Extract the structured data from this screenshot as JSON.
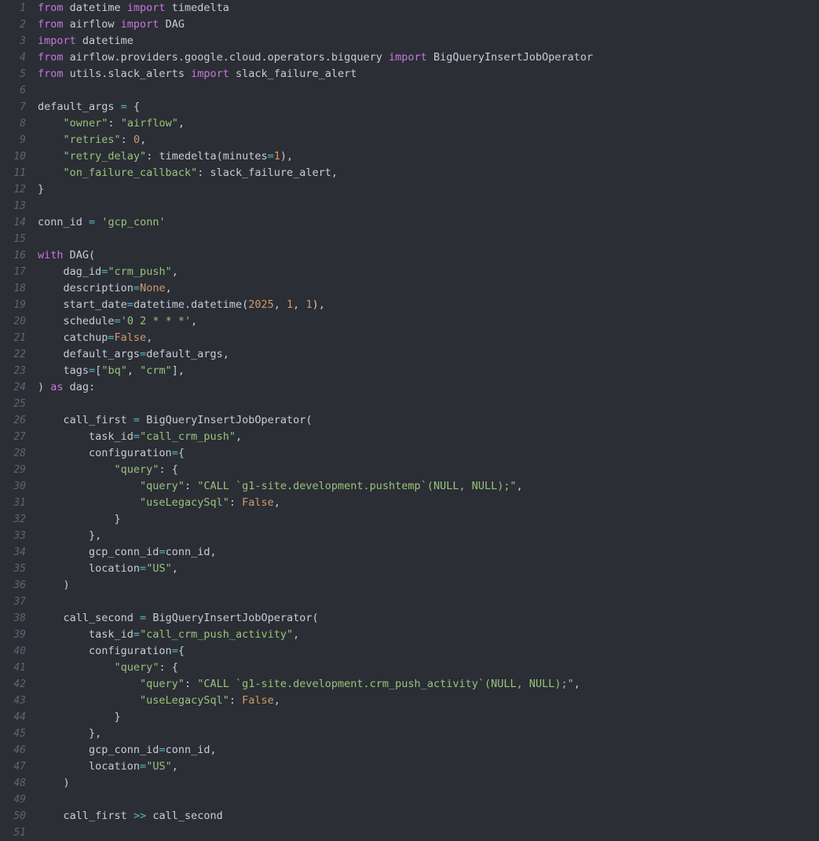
{
  "editor": {
    "language": "python",
    "colors": {
      "background": "#2b2e35",
      "keyword": "#c678dd",
      "string": "#98c379",
      "number": "#d19a66",
      "operator": "#56b6c2",
      "text": "#c7ccd6",
      "line_number": "#5f6470"
    },
    "lines": [
      {
        "n": "1",
        "tokens": [
          [
            "kw",
            "from"
          ],
          [
            "id",
            " datetime "
          ],
          [
            "kw",
            "import"
          ],
          [
            "id",
            " timedelta"
          ]
        ]
      },
      {
        "n": "2",
        "tokens": [
          [
            "kw",
            "from"
          ],
          [
            "id",
            " airflow "
          ],
          [
            "kw",
            "import"
          ],
          [
            "id",
            " DAG"
          ]
        ]
      },
      {
        "n": "3",
        "tokens": [
          [
            "kw",
            "import"
          ],
          [
            "id",
            " datetime"
          ]
        ]
      },
      {
        "n": "4",
        "tokens": [
          [
            "kw",
            "from"
          ],
          [
            "id",
            " airflow.providers.google.cloud.operators.bigquery "
          ],
          [
            "kw",
            "import"
          ],
          [
            "id",
            " BigQueryInsertJobOperator"
          ]
        ]
      },
      {
        "n": "5",
        "tokens": [
          [
            "kw",
            "from"
          ],
          [
            "id",
            " utils.slack_alerts "
          ],
          [
            "kw",
            "import"
          ],
          [
            "id",
            " slack_failure_alert"
          ]
        ]
      },
      {
        "n": "6",
        "tokens": []
      },
      {
        "n": "7",
        "tokens": [
          [
            "id",
            "default_args "
          ],
          [
            "op",
            "="
          ],
          [
            "id",
            " {"
          ]
        ]
      },
      {
        "n": "8",
        "tokens": [
          [
            "id",
            "    "
          ],
          [
            "str",
            "\"owner\""
          ],
          [
            "id",
            ": "
          ],
          [
            "str",
            "\"airflow\""
          ],
          [
            "id",
            ","
          ]
        ]
      },
      {
        "n": "9",
        "tokens": [
          [
            "id",
            "    "
          ],
          [
            "str",
            "\"retries\""
          ],
          [
            "id",
            ": "
          ],
          [
            "num",
            "0"
          ],
          [
            "id",
            ","
          ]
        ]
      },
      {
        "n": "10",
        "tokens": [
          [
            "id",
            "    "
          ],
          [
            "str",
            "\"retry_delay\""
          ],
          [
            "id",
            ": timedelta(minutes"
          ],
          [
            "op",
            "="
          ],
          [
            "num",
            "1"
          ],
          [
            "id",
            "),"
          ]
        ]
      },
      {
        "n": "11",
        "tokens": [
          [
            "id",
            "    "
          ],
          [
            "str",
            "\"on_failure_callback\""
          ],
          [
            "id",
            ": slack_failure_alert,"
          ]
        ]
      },
      {
        "n": "12",
        "tokens": [
          [
            "id",
            "}"
          ]
        ]
      },
      {
        "n": "13",
        "tokens": []
      },
      {
        "n": "14",
        "tokens": [
          [
            "id",
            "conn_id "
          ],
          [
            "op",
            "="
          ],
          [
            "id",
            " "
          ],
          [
            "str",
            "'gcp_conn'"
          ]
        ]
      },
      {
        "n": "15",
        "tokens": []
      },
      {
        "n": "16",
        "tokens": [
          [
            "kw",
            "with"
          ],
          [
            "id",
            " DAG("
          ]
        ]
      },
      {
        "n": "17",
        "tokens": [
          [
            "id",
            "    dag_id"
          ],
          [
            "op",
            "="
          ],
          [
            "str",
            "\"crm_push\""
          ],
          [
            "id",
            ","
          ]
        ]
      },
      {
        "n": "18",
        "tokens": [
          [
            "id",
            "    description"
          ],
          [
            "op",
            "="
          ],
          [
            "num",
            "None"
          ],
          [
            "id",
            ","
          ]
        ]
      },
      {
        "n": "19",
        "tokens": [
          [
            "id",
            "    start_date"
          ],
          [
            "op",
            "="
          ],
          [
            "id",
            "datetime.datetime("
          ],
          [
            "num",
            "2025"
          ],
          [
            "id",
            ", "
          ],
          [
            "num",
            "1"
          ],
          [
            "id",
            ", "
          ],
          [
            "num",
            "1"
          ],
          [
            "id",
            "),"
          ]
        ]
      },
      {
        "n": "20",
        "tokens": [
          [
            "id",
            "    schedule"
          ],
          [
            "op",
            "="
          ],
          [
            "str",
            "'0 2 * * *'"
          ],
          [
            "id",
            ","
          ]
        ]
      },
      {
        "n": "21",
        "tokens": [
          [
            "id",
            "    catchup"
          ],
          [
            "op",
            "="
          ],
          [
            "num",
            "False"
          ],
          [
            "id",
            ","
          ]
        ]
      },
      {
        "n": "22",
        "tokens": [
          [
            "id",
            "    default_args"
          ],
          [
            "op",
            "="
          ],
          [
            "id",
            "default_args,"
          ]
        ]
      },
      {
        "n": "23",
        "tokens": [
          [
            "id",
            "    tags"
          ],
          [
            "op",
            "="
          ],
          [
            "id",
            "["
          ],
          [
            "str",
            "\"bq\""
          ],
          [
            "id",
            ", "
          ],
          [
            "str",
            "\"crm\""
          ],
          [
            "id",
            "],"
          ]
        ]
      },
      {
        "n": "24",
        "tokens": [
          [
            "id",
            ") "
          ],
          [
            "kw",
            "as"
          ],
          [
            "id",
            " dag:"
          ]
        ]
      },
      {
        "n": "25",
        "tokens": []
      },
      {
        "n": "26",
        "tokens": [
          [
            "id",
            "    call_first "
          ],
          [
            "op",
            "="
          ],
          [
            "id",
            " BigQueryInsertJobOperator("
          ]
        ]
      },
      {
        "n": "27",
        "tokens": [
          [
            "id",
            "        task_id"
          ],
          [
            "op",
            "="
          ],
          [
            "str",
            "\"call_crm_push\""
          ],
          [
            "id",
            ","
          ]
        ]
      },
      {
        "n": "28",
        "tokens": [
          [
            "id",
            "        configuration"
          ],
          [
            "op",
            "="
          ],
          [
            "id",
            "{"
          ]
        ]
      },
      {
        "n": "29",
        "tokens": [
          [
            "id",
            "            "
          ],
          [
            "str",
            "\"query\""
          ],
          [
            "id",
            ": {"
          ]
        ]
      },
      {
        "n": "30",
        "tokens": [
          [
            "id",
            "                "
          ],
          [
            "str",
            "\"query\""
          ],
          [
            "id",
            ": "
          ],
          [
            "str",
            "\"CALL `g1-site.development.pushtemp`(NULL, NULL);\""
          ],
          [
            "id",
            ","
          ]
        ]
      },
      {
        "n": "31",
        "tokens": [
          [
            "id",
            "                "
          ],
          [
            "str",
            "\"useLegacySql\""
          ],
          [
            "id",
            ": "
          ],
          [
            "num",
            "False"
          ],
          [
            "id",
            ","
          ]
        ]
      },
      {
        "n": "32",
        "tokens": [
          [
            "id",
            "            }"
          ]
        ]
      },
      {
        "n": "33",
        "tokens": [
          [
            "id",
            "        },"
          ]
        ]
      },
      {
        "n": "34",
        "tokens": [
          [
            "id",
            "        gcp_conn_id"
          ],
          [
            "op",
            "="
          ],
          [
            "id",
            "conn_id,"
          ]
        ]
      },
      {
        "n": "35",
        "tokens": [
          [
            "id",
            "        location"
          ],
          [
            "op",
            "="
          ],
          [
            "str",
            "\"US\""
          ],
          [
            "id",
            ","
          ]
        ]
      },
      {
        "n": "36",
        "tokens": [
          [
            "id",
            "    )"
          ]
        ]
      },
      {
        "n": "37",
        "tokens": []
      },
      {
        "n": "38",
        "tokens": [
          [
            "id",
            "    call_second "
          ],
          [
            "op",
            "="
          ],
          [
            "id",
            " BigQueryInsertJobOperator("
          ]
        ]
      },
      {
        "n": "39",
        "tokens": [
          [
            "id",
            "        task_id"
          ],
          [
            "op",
            "="
          ],
          [
            "str",
            "\"call_crm_push_activity\""
          ],
          [
            "id",
            ","
          ]
        ]
      },
      {
        "n": "40",
        "tokens": [
          [
            "id",
            "        configuration"
          ],
          [
            "op",
            "="
          ],
          [
            "id",
            "{"
          ]
        ]
      },
      {
        "n": "41",
        "tokens": [
          [
            "id",
            "            "
          ],
          [
            "str",
            "\"query\""
          ],
          [
            "id",
            ": {"
          ]
        ]
      },
      {
        "n": "42",
        "tokens": [
          [
            "id",
            "                "
          ],
          [
            "str",
            "\"query\""
          ],
          [
            "id",
            ": "
          ],
          [
            "str",
            "\"CALL `g1-site.development.crm_push_activity`(NULL, NULL);\""
          ],
          [
            "id",
            ","
          ]
        ]
      },
      {
        "n": "43",
        "tokens": [
          [
            "id",
            "                "
          ],
          [
            "str",
            "\"useLegacySql\""
          ],
          [
            "id",
            ": "
          ],
          [
            "num",
            "False"
          ],
          [
            "id",
            ","
          ]
        ]
      },
      {
        "n": "44",
        "tokens": [
          [
            "id",
            "            }"
          ]
        ]
      },
      {
        "n": "45",
        "tokens": [
          [
            "id",
            "        },"
          ]
        ]
      },
      {
        "n": "46",
        "tokens": [
          [
            "id",
            "        gcp_conn_id"
          ],
          [
            "op",
            "="
          ],
          [
            "id",
            "conn_id,"
          ]
        ]
      },
      {
        "n": "47",
        "tokens": [
          [
            "id",
            "        location"
          ],
          [
            "op",
            "="
          ],
          [
            "str",
            "\"US\""
          ],
          [
            "id",
            ","
          ]
        ]
      },
      {
        "n": "48",
        "tokens": [
          [
            "id",
            "    )"
          ]
        ]
      },
      {
        "n": "49",
        "tokens": []
      },
      {
        "n": "50",
        "tokens": [
          [
            "id",
            "    call_first "
          ],
          [
            "op",
            "&gt;&gt;"
          ],
          [
            "id",
            " call_second"
          ]
        ]
      },
      {
        "n": "51",
        "tokens": []
      }
    ]
  }
}
